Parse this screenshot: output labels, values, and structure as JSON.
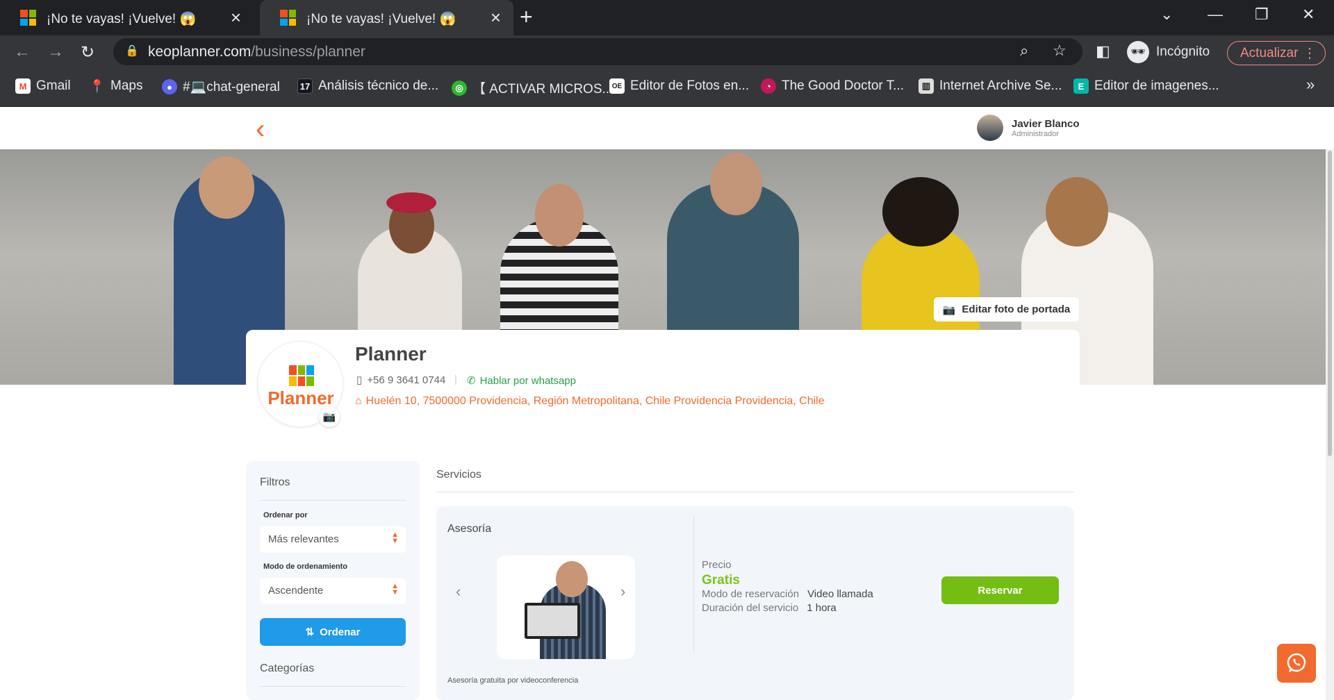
{
  "browser": {
    "tabs": [
      {
        "title": "¡No te vayas! ¡Vuelve! 😱"
      },
      {
        "title": "¡No te vayas! ¡Vuelve! 😱"
      }
    ],
    "url_host": "keoplanner.com",
    "url_path": "/business/planner",
    "profile_label": "Incógnito",
    "update_label": "Actualizar",
    "bookmarks": [
      {
        "label": "Gmail",
        "color": "#ea4335",
        "glyph": "M"
      },
      {
        "label": "Maps",
        "color": "#34a853",
        "glyph": "◉"
      },
      {
        "label": "#💻chat-general",
        "color": "#5865f2",
        "glyph": "●"
      },
      {
        "label": "Análisis técnico de...",
        "color": "#131722",
        "glyph": "17"
      },
      {
        "label": "【 ACTIVAR MICROS...",
        "color": "#2eb82e",
        "glyph": "◎"
      },
      {
        "label": "Editor de Fotos en...",
        "color": "#ffffff",
        "glyph": "OE"
      },
      {
        "label": "The Good Doctor T...",
        "color": "#c2185b",
        "glyph": "◔"
      },
      {
        "label": "Internet Archive Se...",
        "color": "#cccccc",
        "glyph": "▥"
      },
      {
        "label": "Editor de imagenes...",
        "color": "#00b8a9",
        "glyph": "E"
      }
    ],
    "more": "»"
  },
  "header": {
    "user_name": "Javier Blanco",
    "user_role": "Administrador"
  },
  "cover": {
    "edit_label": "Editar foto de portada"
  },
  "business": {
    "name": "Planner",
    "logo_word": "Planner",
    "phone": "+56 9 3641 0744",
    "separator": "|",
    "whatsapp_label": "Hablar por whatsapp",
    "address": "Huelén 10, 7500000 Providencia, Región Metropolitana, Chile Providencia Providencia, Chile"
  },
  "filters": {
    "title": "Filtros",
    "order_by_label": "Ordenar por",
    "order_by_value": "Más relevantes",
    "order_mode_label": "Modo de ordenamiento",
    "order_mode_value": "Ascendente",
    "order_button": "Ordenar",
    "categories_title": "Categorías"
  },
  "services": {
    "title": "Servicios",
    "card": {
      "name": "Asesoría",
      "caption": "Asesoría gratuita por videoconferencia",
      "price_label": "Precio",
      "price_value": "Gratis",
      "mode_label": "Modo de reservación",
      "mode_value": "Video llamada",
      "duration_label": "Duración del servicio",
      "duration_value": "1 hora",
      "book_button": "Reservar"
    }
  },
  "colors": {
    "accent": "#f26a2e",
    "primary_button": "#1f9bea",
    "book_button": "#74be14",
    "whatsapp": "#25a244"
  }
}
